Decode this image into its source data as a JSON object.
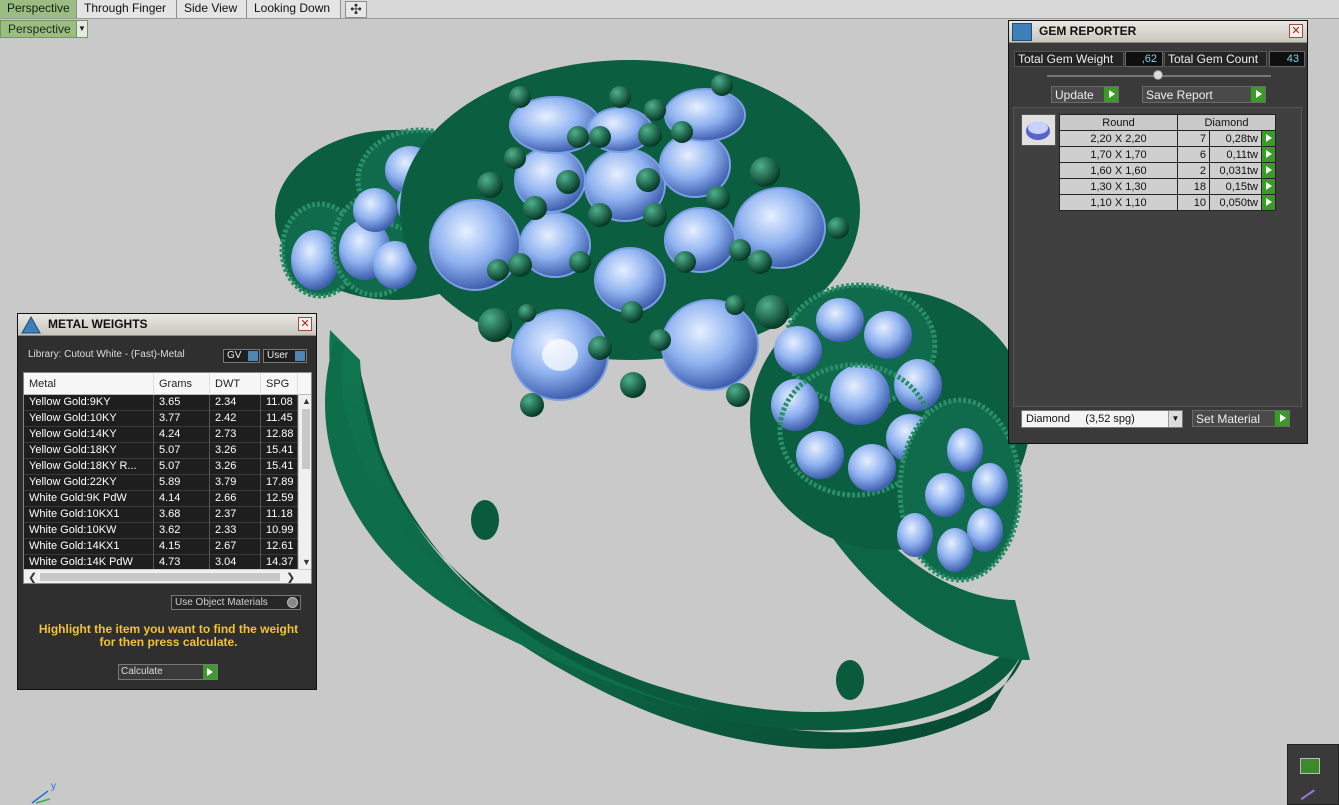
{
  "tabs": [
    {
      "label": "Perspective",
      "active": true
    },
    {
      "label": "Through Finger",
      "active": false
    },
    {
      "label": "Side View",
      "active": false
    },
    {
      "label": "Looking Down",
      "active": false
    }
  ],
  "add_tab_symbol": "✣",
  "viewport_mode": "Perspective",
  "gem_reporter": {
    "title": "GEM REPORTER",
    "total_weight_label": "Total Gem Weight",
    "total_weight_value": ",62",
    "total_count_label": "Total Gem Count",
    "total_count_value": "43",
    "update_label": "Update",
    "save_report_label": "Save Report",
    "col_shape": "Round",
    "col_stone": "Diamond",
    "rows": [
      {
        "size": "2,20 X 2,20",
        "count": "7",
        "weight": "0,28tw"
      },
      {
        "size": "1,70 X 1,70",
        "count": "6",
        "weight": "0,11tw"
      },
      {
        "size": "1,60 X 1,60",
        "count": "2",
        "weight": "0,031tw"
      },
      {
        "size": "1,30 X 1,30",
        "count": "18",
        "weight": "0,15tw"
      },
      {
        "size": "1,10 X 1,10",
        "count": "10",
        "weight": "0,050tw"
      }
    ],
    "material_value": "Diamond     (3,52 spg)",
    "set_material_label": "Set Material"
  },
  "metal_weights": {
    "title": "METAL WEIGHTS",
    "library_label": "Library: Cutout White - (Fast)-Metal",
    "gv_label": "GV",
    "user_label": "User",
    "columns": [
      "Metal",
      "Grams",
      "DWT",
      "SPG"
    ],
    "rows": [
      {
        "metal": "Yellow Gold:9KY",
        "grams": "3.65",
        "dwt": "2.34",
        "spg": "11.08"
      },
      {
        "metal": "Yellow Gold:10KY",
        "grams": "3.77",
        "dwt": "2.42",
        "spg": "11.45"
      },
      {
        "metal": "Yellow Gold:14KY",
        "grams": "4.24",
        "dwt": "2.73",
        "spg": "12.88"
      },
      {
        "metal": "Yellow Gold:18KY",
        "grams": "5.07",
        "dwt": "3.26",
        "spg": "15.41"
      },
      {
        "metal": "Yellow Gold:18KY R...",
        "grams": "5.07",
        "dwt": "3.26",
        "spg": "15.41"
      },
      {
        "metal": "Yellow Gold:22KY",
        "grams": "5.89",
        "dwt": "3.79",
        "spg": "17.89"
      },
      {
        "metal": "White Gold:9K PdW",
        "grams": "4.14",
        "dwt": "2.66",
        "spg": "12.59"
      },
      {
        "metal": "White Gold:10KX1",
        "grams": "3.68",
        "dwt": "2.37",
        "spg": "11.18"
      },
      {
        "metal": "White Gold:10KW",
        "grams": "3.62",
        "dwt": "2.33",
        "spg": "10.99"
      },
      {
        "metal": "White Gold:14KX1",
        "grams": "4.15",
        "dwt": "2.67",
        "spg": "12.61"
      },
      {
        "metal": "White Gold:14K PdW",
        "grams": "4.73",
        "dwt": "3.04",
        "spg": "14.37"
      }
    ],
    "use_object_materials_label": "Use Object Materials",
    "hint_line1": "Highlight the item you want to find the weight",
    "hint_line2": "for then press calculate.",
    "calculate_label": "Calculate"
  },
  "colors": {
    "metal_green": "#0f6b4c",
    "gem_blue": "#8fb2f0",
    "accent_green": "#9bbd84",
    "hint_yellow": "#f2c23a"
  },
  "axis_label": "y"
}
